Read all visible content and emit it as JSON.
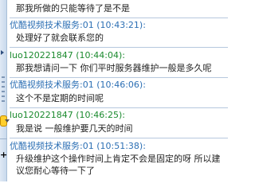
{
  "messages": [
    {
      "type": "message",
      "text": "那我所做的只能等待了是不是"
    },
    {
      "sender": "优酷视频技术服务:01",
      "time": "(10:43:21):",
      "role": "agent",
      "text": "处理好了就会联系您的"
    },
    {
      "sender": "luo120221847",
      "time": "(10:44:04):",
      "role": "user",
      "text": "那我想请问一下 你们平时服务器维护一般是多久呢"
    },
    {
      "sender": "优酷视频技术服务:01",
      "time": "(10:46:06):",
      "role": "agent",
      "text": "这个不是定期的时间呢"
    },
    {
      "sender": "luo120221847",
      "time": "(10:46:25):",
      "role": "user",
      "text": "我是说 一般维护要几天的时间"
    },
    {
      "sender": "优酷视频技术服务:01",
      "time": "(10:51:38):",
      "role": "agent",
      "text_lines": [
        "升级维护这个操作时间上肯定不会是固定的呀  所以建",
        "议您耐心等待一下了"
      ]
    }
  ]
}
